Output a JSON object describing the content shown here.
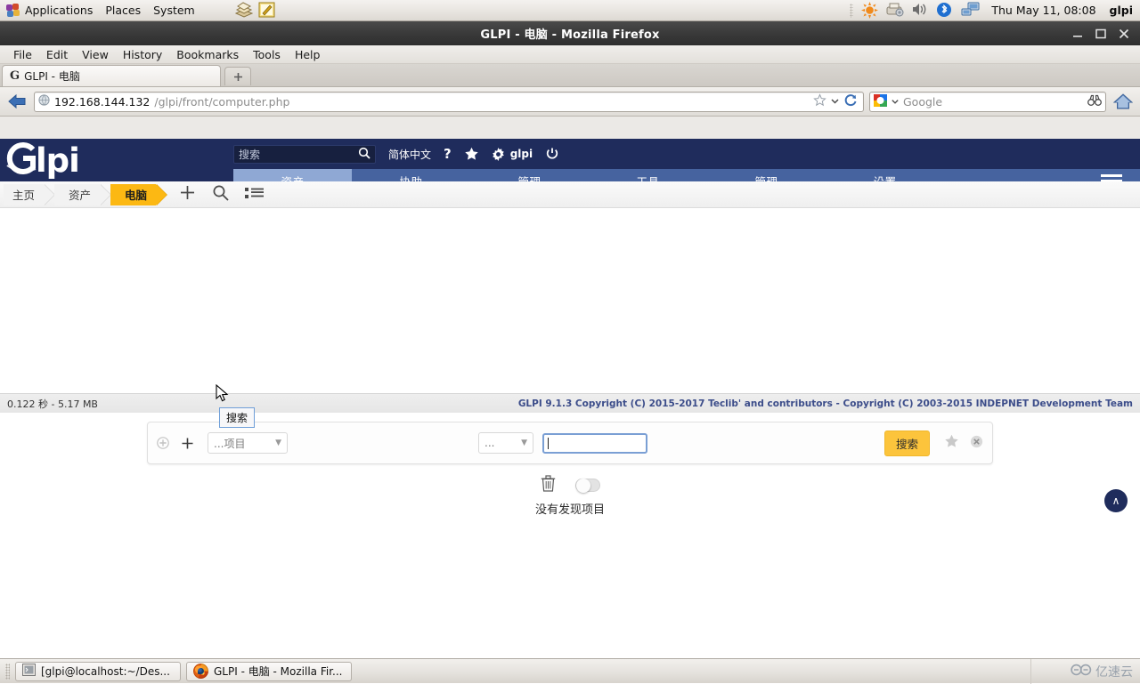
{
  "desktop": {
    "menus": [
      "Applications",
      "Places",
      "System"
    ],
    "launchers": [
      "firefox-icon",
      "help-book-icon",
      "text-editor-icon"
    ],
    "tray": [
      "brightness-icon",
      "printer-icon",
      "volume-icon",
      "bluetooth-icon",
      "network-icon"
    ],
    "clock": "Thu May 11, 08:08",
    "user": "glpi"
  },
  "browser": {
    "title": "GLPI - 电脑 - Mozilla Firefox",
    "menu": [
      "File",
      "Edit",
      "View",
      "History",
      "Bookmarks",
      "Tools",
      "Help"
    ],
    "tab": {
      "title": "GLPI - 电脑",
      "favicon": "G"
    },
    "newtab_label": "+",
    "url_host": "192.168.144.132",
    "url_path": "/glpi/front/computer.php",
    "search_placeholder": "Google",
    "search_engine": "google-icon",
    "window_buttons": [
      "minimize",
      "maximize",
      "close"
    ]
  },
  "glpi": {
    "logo": "lpi",
    "search_placeholder": "搜索",
    "header_links": {
      "language": "简体中文",
      "help": "?",
      "favorites": "star",
      "settings_user": "glpi",
      "logout": "power"
    },
    "nav": [
      {
        "label": "资产",
        "active": true
      },
      {
        "label": "协助",
        "active": false
      },
      {
        "label": "管理",
        "active": false
      },
      {
        "label": "工具",
        "active": false
      },
      {
        "label": "管理",
        "active": false
      },
      {
        "label": "设置",
        "active": false
      }
    ],
    "breadcrumb": [
      {
        "label": "主页",
        "active": false
      },
      {
        "label": "资产",
        "active": false
      },
      {
        "label": "电脑",
        "active": true
      }
    ],
    "breadcrumb_actions": [
      "plus-icon",
      "search-icon",
      "list-icon"
    ],
    "tooltip": "搜索",
    "search_form": {
      "add_group_icon": "add-group-icon",
      "add_icon": "+",
      "field_select": "...项目",
      "operator_select": "...",
      "value": "",
      "search_button": "搜索",
      "save_icon": "star-icon",
      "reset_icon": "reset-icon"
    },
    "list_controls": {
      "trash_icon": "trash-icon",
      "toggle": "off"
    },
    "empty_message": "没有发现项目",
    "scroll_top": "∧",
    "footer_left": "0.122 秒 - 5.17 MB",
    "footer_right": "GLPI 9.1.3 Copyright (C) 2015-2017 Teclib' and contributors - Copyright (C) 2003-2015 INDEPNET Development Team"
  },
  "statusbar": {
    "url": "192.168.144.132/glpi/front/computer.php"
  },
  "taskbar": {
    "items": [
      {
        "label": "[glpi@localhost:~/Des...",
        "icon": "terminal-icon"
      },
      {
        "label": "GLPI - 电脑 - Mozilla Fir...",
        "icon": "firefox-icon"
      }
    ],
    "watermark": "亿速云"
  },
  "colors": {
    "glpi_dark": "#1f2c5c",
    "glpi_nav": "#46639f",
    "glpi_nav_active": "#8fa8d4",
    "accent_orange": "#fcb813",
    "button_orange": "#fcc43c"
  }
}
